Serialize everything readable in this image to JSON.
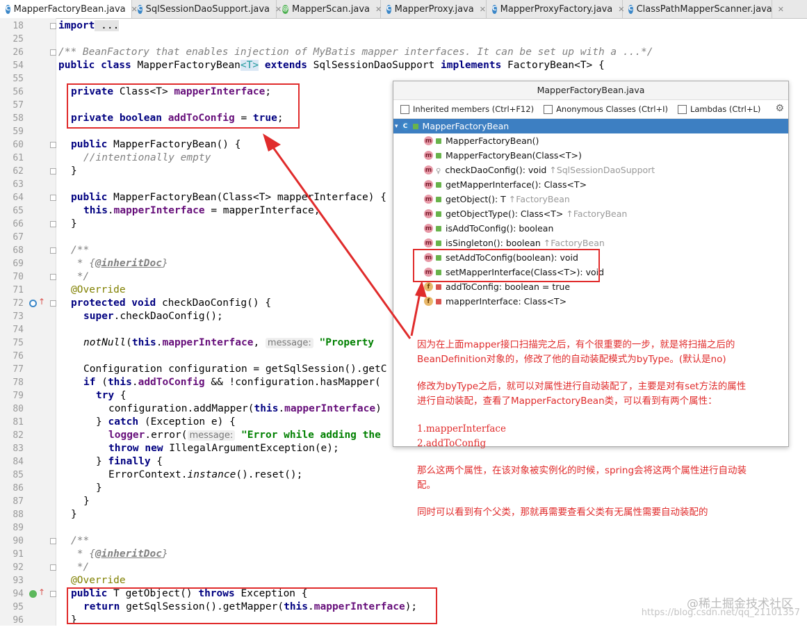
{
  "tabs": [
    {
      "label": "MapperFactoryBean.java",
      "icon": "class-icon",
      "active": true
    },
    {
      "label": "SqlSessionDaoSupport.java",
      "icon": "class-icon",
      "active": false
    },
    {
      "label": "MapperScan.java",
      "icon": "annotation-icon",
      "active": false
    },
    {
      "label": "MapperProxy.java",
      "icon": "class-icon",
      "active": false
    },
    {
      "label": "MapperProxyFactory.java",
      "icon": "class-icon",
      "active": false
    },
    {
      "label": "ClassPathMapperScanner.java",
      "icon": "class-icon",
      "active": false
    }
  ],
  "line_numbers": [
    "18",
    "25",
    "26",
    "54",
    "55",
    "56",
    "57",
    "58",
    "59",
    "60",
    "61",
    "62",
    "63",
    "64",
    "65",
    "66",
    "67",
    "68",
    "69",
    "70",
    "71",
    "72",
    "73",
    "74",
    "75",
    "76",
    "77",
    "78",
    "79",
    "80",
    "81",
    "82",
    "83",
    "84",
    "85",
    "86",
    "87",
    "88",
    "89",
    "90",
    "91",
    "92",
    "93",
    "94",
    "95",
    "96"
  ],
  "code": {
    "l18": {
      "kw": "import",
      "rest": " ..."
    },
    "l26": "/** BeanFactory that enables injection of MyBatis mapper interfaces. It can be set up with a ...*/",
    "l54": {
      "kw1": "public class",
      "name": " MapperFactoryBean",
      "tp": "<T>",
      "kw2": " extends",
      "mid": " SqlSessionDaoSupport ",
      "kw3": "implements",
      "end": " FactoryBean<T> {"
    },
    "l56": {
      "kw": "private",
      "type": " Class<T> ",
      "fld": "mapperInterface",
      "end": ";"
    },
    "l58": {
      "kw": "private boolean",
      "sp": " ",
      "fld": "addToConfig",
      "eq": " = ",
      "kw2": "true",
      "end": ";"
    },
    "l60": {
      "kw": "public",
      "rest": " MapperFactoryBean() {"
    },
    "l61": "//intentionally empty",
    "l62": "}",
    "l64": {
      "kw": "public",
      "rest": " MapperFactoryBean(Class<T> mapperInterface) {"
    },
    "l65": {
      "kw": "this",
      "dot": ".",
      "fld": "mapperInterface",
      "rest": " = mapperInterface;"
    },
    "l66": "}",
    "l68": "/**",
    "l69": {
      "pre": " * {",
      "tag": "@inheritDoc",
      "post": "}"
    },
    "l70": " */",
    "l71": "@Override",
    "l72": {
      "kw": "protected void",
      "rest": " checkDaoConfig() {"
    },
    "l73": {
      "kw": "super",
      "rest": ".checkDaoConfig();"
    },
    "l75": {
      "fn": "notNull",
      "p1": "(",
      "kw": "this",
      "dot": ".",
      "fld": "mapperInterface",
      "comma": ", ",
      "hint": "message:",
      "str": " \"Property"
    },
    "l77": "Configuration configuration = getSqlSession().getC",
    "l78": {
      "kw": "if",
      "p": " (",
      "kw2": "this",
      "dot": ".",
      "fld": "addToConfig",
      "rest": " && !configuration.hasMapper("
    },
    "l79": {
      "kw": "try",
      "rest": " {"
    },
    "l80": {
      "pre": "configuration.addMapper(",
      "kw": "this",
      "dot": ".",
      "fld": "mapperInterface",
      "post": ")"
    },
    "l81": {
      "pre": "} ",
      "kw": "catch",
      "rest": " (Exception e) {"
    },
    "l82": {
      "fld": "logger",
      "pre": ".error(",
      "hint": "message:",
      "str": " \"Error while adding the"
    },
    "l83": {
      "kw": "throw new",
      "rest": " IllegalArgumentException(e);"
    },
    "l84": {
      "pre": "} ",
      "kw": "finally",
      "rest": " {"
    },
    "l85": {
      "pre": "ErrorContext.",
      "it": "instance",
      "rest": "().reset();"
    },
    "l86": "}",
    "l87": "}",
    "l88": "}",
    "l90": "/**",
    "l91": {
      "pre": " * {",
      "tag": "@inheritDoc",
      "post": "}"
    },
    "l92": " */",
    "l93": "@Override",
    "l94": {
      "kw": "public",
      "mid": " T getObject() ",
      "kw2": "throws",
      "rest": " Exception {"
    },
    "l95": {
      "kw": "return",
      "pre": " getSqlSession().getMapper(",
      "kw2": "this",
      "dot": ".",
      "fld": "mapperInterface",
      "end": ");"
    },
    "l96": "}"
  },
  "popup": {
    "title": "MapperFactoryBean.java",
    "checks": [
      "Inherited members (Ctrl+F12)",
      "Anonymous Classes (Ctrl+I)",
      "Lambdas (Ctrl+L)"
    ],
    "root": "MapperFactoryBean",
    "members": [
      {
        "kind": "m",
        "access": "public",
        "sig": "MapperFactoryBean()",
        "from": ""
      },
      {
        "kind": "m",
        "access": "public",
        "sig": "MapperFactoryBean(Class<T>)",
        "from": ""
      },
      {
        "kind": "m",
        "access": "protected",
        "sig": "checkDaoConfig(): void",
        "from": "↑SqlSessionDaoSupport"
      },
      {
        "kind": "m",
        "access": "public",
        "sig": "getMapperInterface(): Class<T>",
        "from": ""
      },
      {
        "kind": "m",
        "access": "public",
        "sig": "getObject(): T",
        "from": "↑FactoryBean"
      },
      {
        "kind": "m",
        "access": "public",
        "sig": "getObjectType(): Class<T>",
        "from": "↑FactoryBean"
      },
      {
        "kind": "m",
        "access": "public",
        "sig": "isAddToConfig(): boolean",
        "from": ""
      },
      {
        "kind": "m",
        "access": "public",
        "sig": "isSingleton(): boolean",
        "from": "↑FactoryBean"
      },
      {
        "kind": "m",
        "access": "public",
        "sig": "setAddToConfig(boolean): void",
        "from": ""
      },
      {
        "kind": "m",
        "access": "public",
        "sig": "setMapperInterface(Class<T>): void",
        "from": ""
      },
      {
        "kind": "f",
        "access": "private",
        "sig": "addToConfig: boolean = true",
        "from": ""
      },
      {
        "kind": "f",
        "access": "private",
        "sig": "mapperInterface: Class<T>",
        "from": ""
      }
    ]
  },
  "annotations": {
    "p1a": "因为在上面mapper接口扫描完之后，有个很重要的一步，就是将扫描之后的",
    "p1b": "BeanDefinition对象的，修改了他的自动装配模式为byType。(默认是no)",
    "p2a": "修改为byType之后，就可以对属性进行自动装配了，主要是对有set方法的属性",
    "p2b": "进行自动装配，查看了MapperFactoryBean类，可以看到有两个属性：",
    "p3a": "1.mapperInterface",
    "p3b": "2.addToConfig",
    "p4a": "那么这两个属性，在该对象被实例化的时候，spring会将这两个属性进行自动装",
    "p4b": "配。",
    "p5": "同时可以看到有个父类，那就再需要查看父类有无属性需要自动装配的"
  },
  "watermark": {
    "main": "@稀土掘金技术社区",
    "url": "https://blog.csdn.net/qq_21101357"
  },
  "colors": {
    "annotation_red": "#e02b2b",
    "selection_blue": "#3d7fc2",
    "keyword": "#000080",
    "field": "#660e7a"
  }
}
